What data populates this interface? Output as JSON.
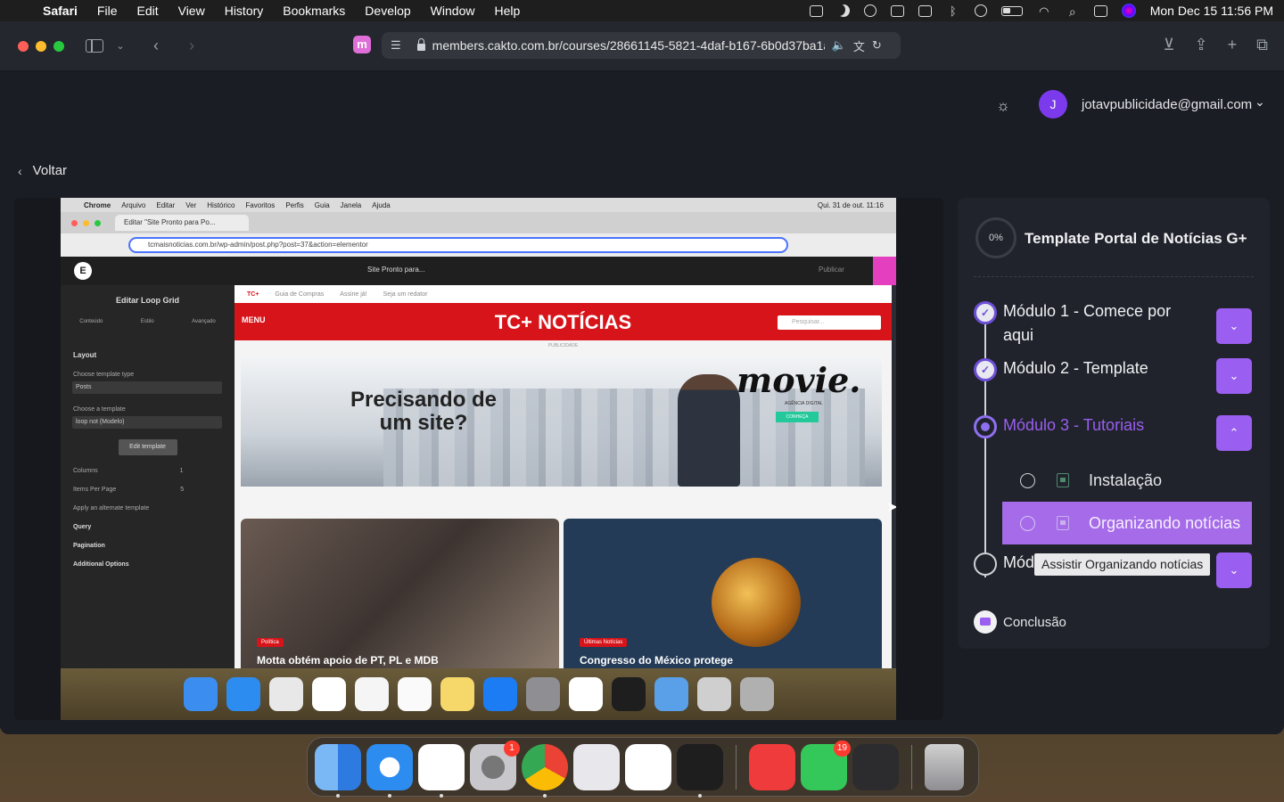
{
  "menubar": {
    "app": "Safari",
    "items": [
      "File",
      "Edit",
      "View",
      "History",
      "Bookmarks",
      "Develop",
      "Window",
      "Help"
    ],
    "clock": "Mon Dec 15  11:56 PM"
  },
  "browser": {
    "url": "members.cakto.com.br/courses/28661145-5821-4daf-b167-6b0d37ba1a"
  },
  "page": {
    "user_initial": "J",
    "user_email": "jotavpublicidade@gmail.com",
    "back_label": "Voltar"
  },
  "video": {
    "inner_menubar": [
      "Chrome",
      "Arquivo",
      "Editar",
      "Ver",
      "Histórico",
      "Favoritos",
      "Perfis",
      "Guia",
      "Janela",
      "Ajuda"
    ],
    "inner_clock": "Qui. 31 de out. 11:16",
    "tab_title": "Editar \"Site Pronto para Po...",
    "address": "tcmaisnoticias.com.br/wp-admin/post.php?post=37&action=elementor",
    "editor_title": "Site Pronto para...",
    "publish": "Publicar",
    "panel": {
      "title": "Editar Loop Grid",
      "tabs": [
        "Conteúdo",
        "Estilo",
        "Avançado"
      ],
      "section": "Layout",
      "template_type_label": "Choose template type",
      "template_type_value": "Posts",
      "template_label": "Choose a template",
      "template_value": "loop not (Modelo)",
      "edit_button": "Edit template",
      "columns_label": "Columns",
      "columns_value": "1",
      "items_label": "Items Per Page",
      "items_value": "5",
      "alternate_label": "Apply an alternate template",
      "query": "Query",
      "pagination": "Pagination",
      "additional": "Additional Options"
    },
    "site": {
      "topnav": [
        "TC+",
        "Guia de Compras",
        "Assine já!",
        "Seja um redator"
      ],
      "menu": "MENU",
      "brand": "TC+ NOTÍCIAS",
      "search_placeholder": "Pesquisar...",
      "pub_tag": "PUBLICIDADE",
      "headline": "Precisando de um site?",
      "ad_brand": "movie.",
      "ad_sub": "AGÊNCIA DIGITAL",
      "ad_cta": "CONHEÇA",
      "card1_tag": "Política",
      "card1_title": "Motta obtém apoio de PT, PL e MDB",
      "card2_tag": "Últimas Notícias",
      "card2_title": "Congresso do México protege"
    }
  },
  "course": {
    "progress": "0%",
    "title": "Template Portal de Notícias G+",
    "modules": [
      {
        "label": "Módulo 1 - Comece por aqui",
        "state": "done",
        "toggle": "⌄"
      },
      {
        "label": "Módulo 2 - Template",
        "state": "done",
        "toggle": "⌄"
      },
      {
        "label": "Módulo 3 - Tutoriais",
        "state": "current",
        "toggle": "⌃"
      },
      {
        "label": "Módulo 4 - Bônus",
        "state": "todo",
        "toggle": "⌄"
      }
    ],
    "lessons": [
      {
        "label": "Instalação"
      },
      {
        "label": "Organizando notícias"
      }
    ],
    "tooltip": "Assistir Organizando notícias",
    "conclusion": "Conclusão"
  },
  "dock": {
    "badges": {
      "settings": "1",
      "facetime": "19"
    }
  }
}
